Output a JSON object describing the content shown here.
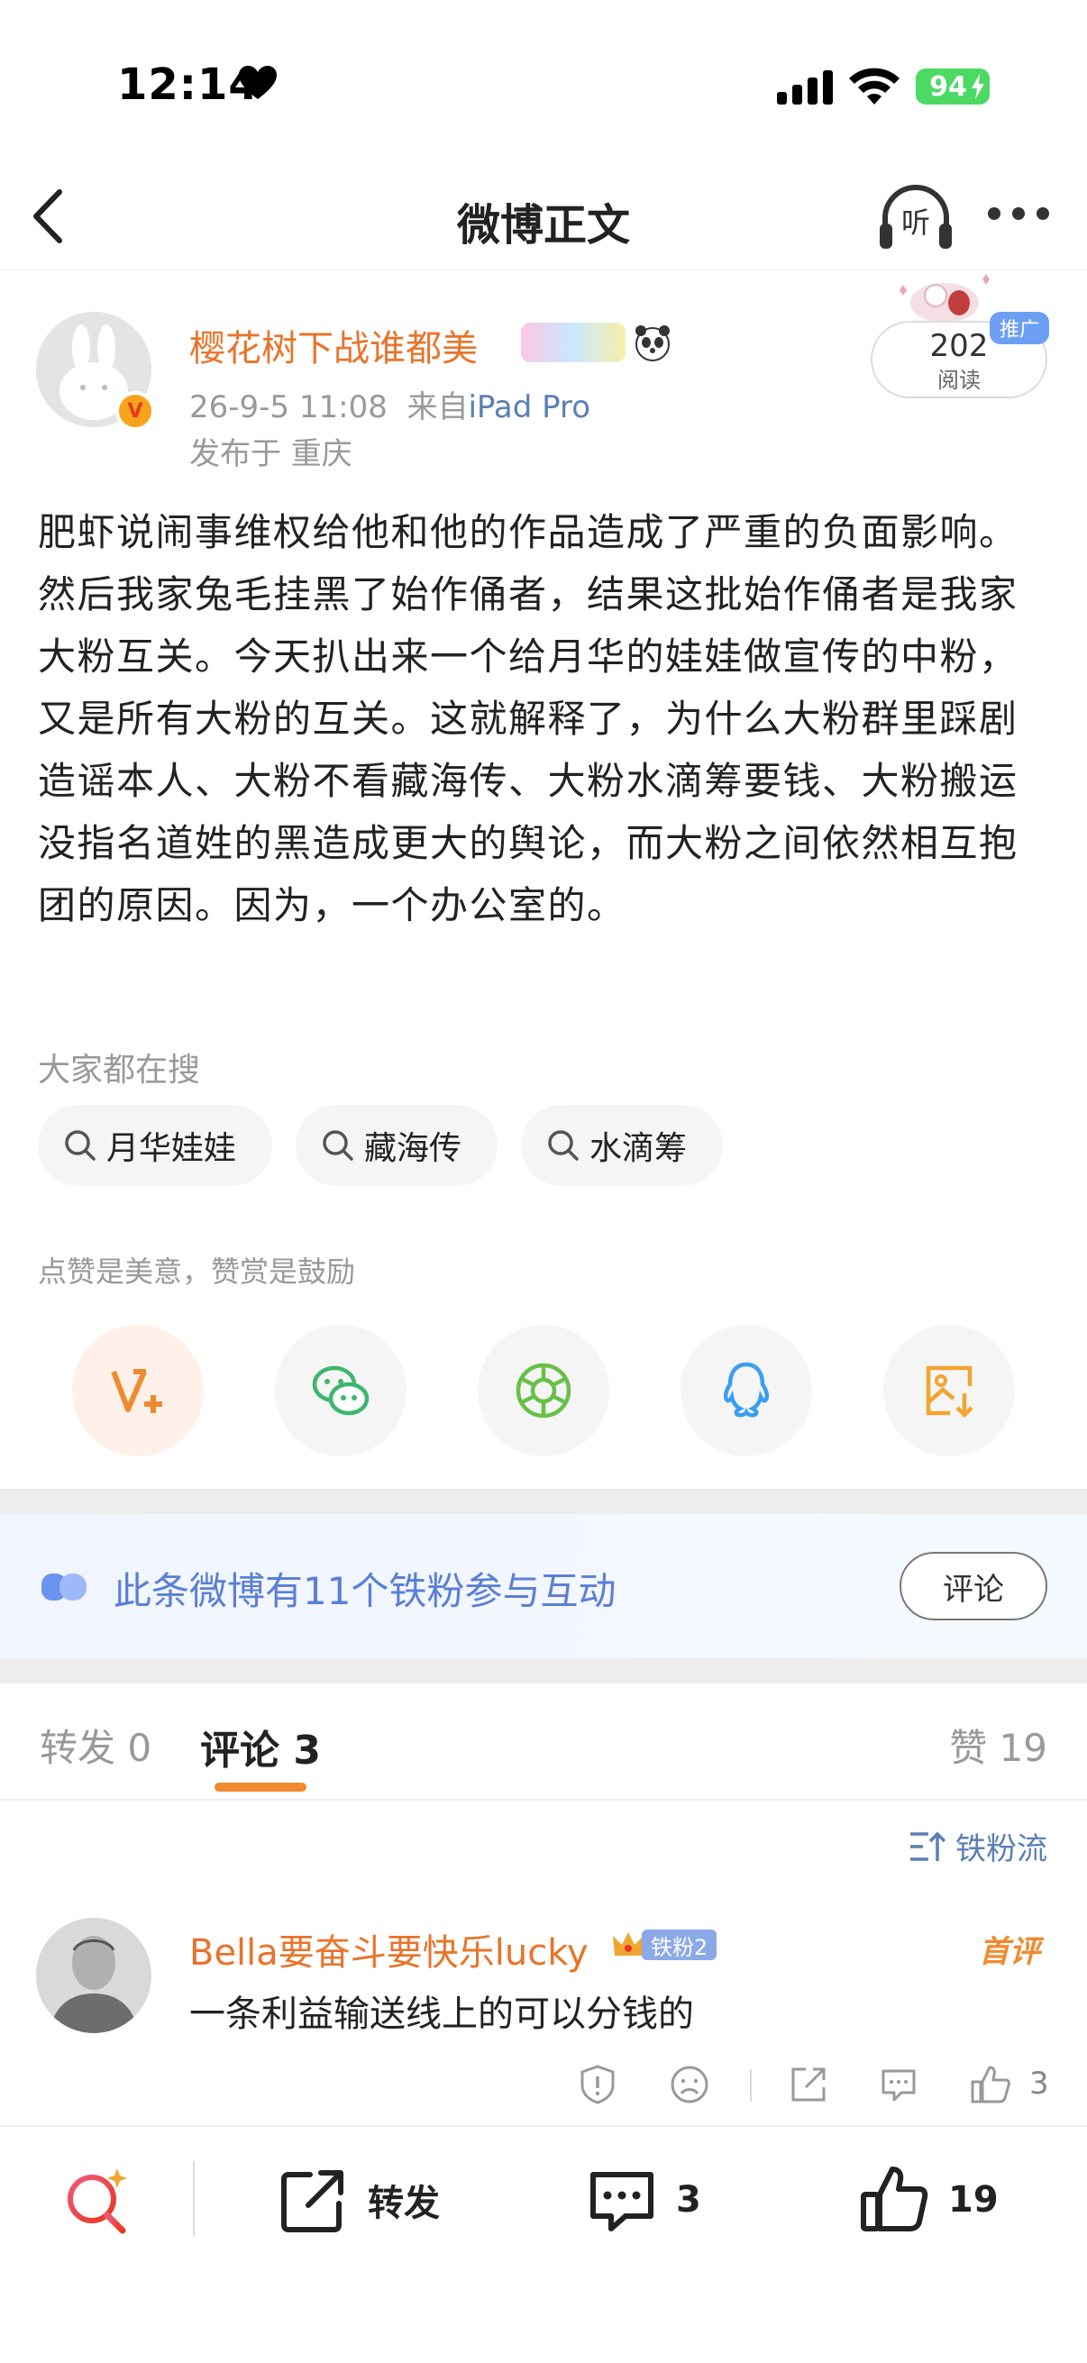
{
  "status_bar": {
    "time": "12:14",
    "battery": "94"
  },
  "header": {
    "title": "微博正文",
    "listen_label": "听"
  },
  "post": {
    "author": "樱花树下战谁都美",
    "verified_badge": "V",
    "date": "26-9-5 11:08",
    "source_prefix": "来自",
    "source": "iPad Pro",
    "location": "发布于 重庆",
    "read_count": "202",
    "read_label": "阅读",
    "promo_tag": "推广",
    "content": "肥虾说闹事维权给他和他的作品造成了严重的负面影响。然后我家兔毛挂黑了始作俑者，结果这批始作俑者是我家大粉互关。今天扒出来一个给月华的娃娃做宣传的中粉，又是所有大粉的互关。这就解释了，为什么大粉群里踩剧造谣本人、大粉不看藏海传、大粉水滴筹要钱、大粉搬运没指名道姓的黑造成更大的舆论，而大粉之间依然相互抱团的原因。因为，一个办公室的。"
  },
  "search": {
    "label": "大家都在搜",
    "chips": [
      "月华娃娃",
      "藏海传",
      "水滴筹"
    ]
  },
  "praise_text": "点赞是美意，赞赏是鼓励",
  "share_icons": [
    "v-plus-icon",
    "wechat-icon",
    "moments-icon",
    "qq-icon",
    "save-image-icon"
  ],
  "fans": {
    "text": "此条微博有11个铁粉参与互动",
    "button": "评论"
  },
  "tabs": {
    "repost": "转发 0",
    "comment": "评论 3",
    "like": "赞 19"
  },
  "iron_flow": "铁粉流",
  "comment": {
    "name": "Bella要奋斗要快乐lucky",
    "badge": "铁粉2",
    "first_tag": "首评",
    "text": "一条利益输送线上的可以分钱的",
    "like_count": "3"
  },
  "bottom_bar": {
    "repost": "转发",
    "comment_count": "3",
    "like_count": "19"
  },
  "colors": {
    "accent_orange": "#e8742b",
    "link_blue": "#5b7fb5",
    "fans_blue": "#5b7fd6"
  }
}
